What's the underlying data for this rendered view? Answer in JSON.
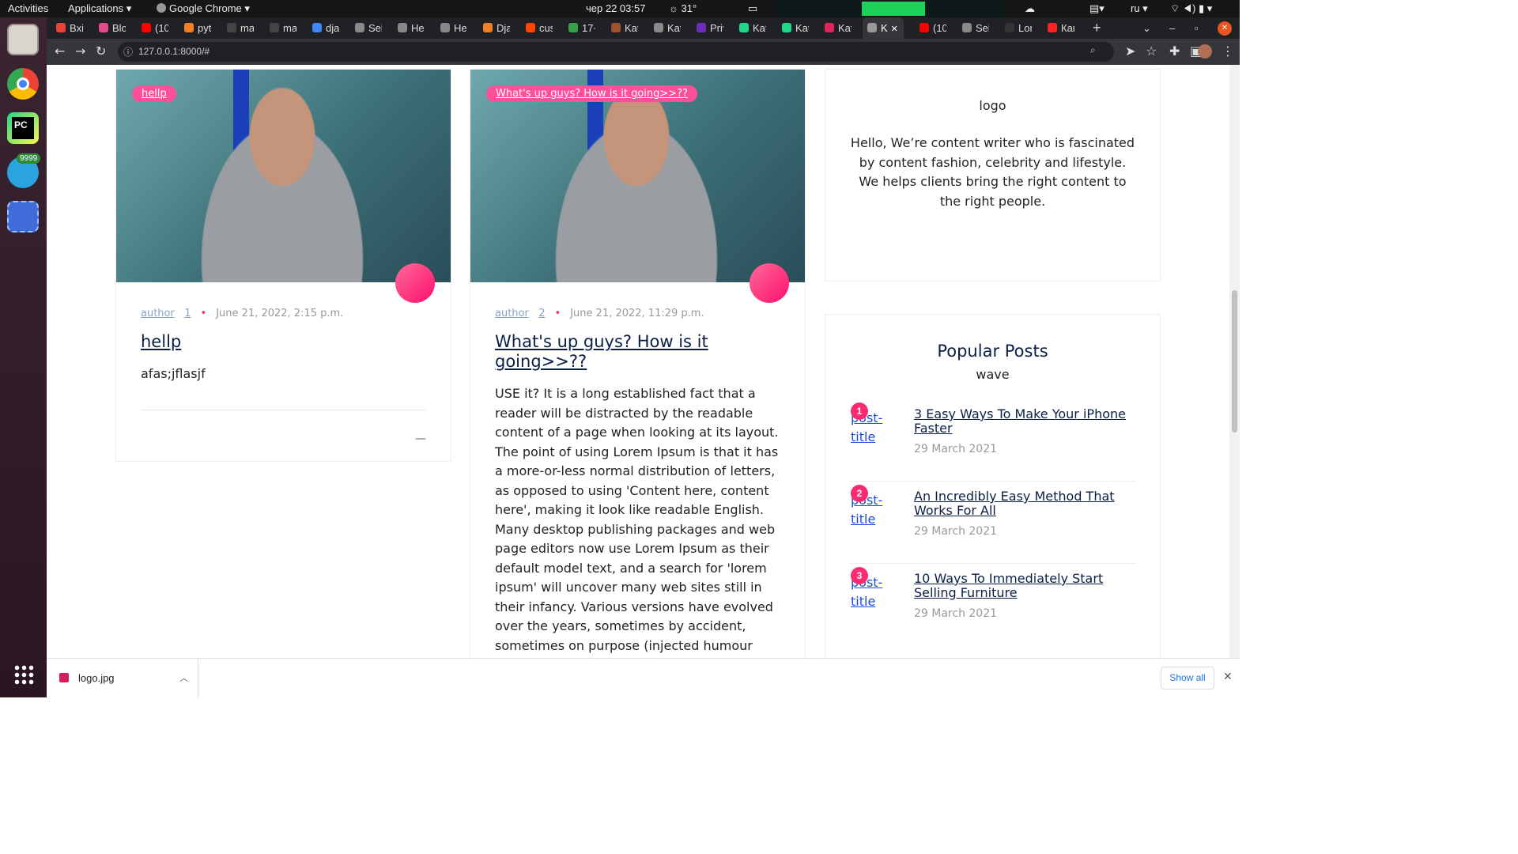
{
  "topbar": {
    "activities": "Activities",
    "applications": "Applications ▾",
    "app_name": "Google Chrome ▾",
    "clock": "чер 22  03:57",
    "temp": "31°",
    "lang": "ru ▾"
  },
  "tabs": [
    {
      "label": "Bxi",
      "color": "#ea4335"
    },
    {
      "label": "Blo",
      "color": "#e64a8a"
    },
    {
      "label": "(10",
      "color": "#ff0000"
    },
    {
      "label": "pyt",
      "color": "#f48024"
    },
    {
      "label": "mar",
      "color": "#444"
    },
    {
      "label": "mar",
      "color": "#444"
    },
    {
      "label": "dja",
      "color": "#4285f4"
    },
    {
      "label": "Sel",
      "color": "#888"
    },
    {
      "label": "Hel",
      "color": "#888"
    },
    {
      "label": "Hel",
      "color": "#888"
    },
    {
      "label": "Dja",
      "color": "#f48024"
    },
    {
      "label": "cus",
      "color": "#ff4500"
    },
    {
      "label": "17+",
      "color": "#37a04a"
    },
    {
      "label": "Kat",
      "color": "#a0522d"
    },
    {
      "label": "Kat",
      "color": "#888"
    },
    {
      "label": "Priv",
      "color": "#6b2fbb"
    },
    {
      "label": "Kat",
      "color": "#21d789"
    },
    {
      "label": "Kat",
      "color": "#21d789"
    },
    {
      "label": "Kat",
      "color": "#e0245e"
    },
    {
      "label": "K",
      "color": "#999",
      "active": true
    },
    {
      "label": "(10",
      "color": "#ff0000"
    },
    {
      "label": "Sel",
      "color": "#888"
    },
    {
      "label": "Lor",
      "color": "#333"
    },
    {
      "label": "Как",
      "color": "#f22"
    }
  ],
  "address": {
    "url": "127.0.0.1:8000/#"
  },
  "dock": {
    "telegram_badge": "9999"
  },
  "posts": [
    {
      "tag": "hellp",
      "author_alt": "author",
      "comments": "1",
      "date": "June 21, 2022, 2:15 p.m.",
      "title": "hellp",
      "excerpt": "afas;jflasjf",
      "dash": "—"
    },
    {
      "tag": "What's up guys? How is it going>>??",
      "author_alt": "author",
      "comments": "2",
      "date": "June 21, 2022, 11:29 p.m.",
      "title": "What's up guys? How is it going>>??",
      "excerpt": "USE it? It is a long established fact that a reader will be distracted by the readable content of a page when looking at its layout. The point of using Lorem Ipsum is that it has a more-or-less normal distribution of letters, as opposed to using 'Content here, content here', making it look like readable English. Many desktop publishing packages and web page editors now use Lorem Ipsum as their default model text, and a search for 'lorem ipsum' will uncover many web sites still in their infancy. Various versions have evolved over the years, sometimes by accident, sometimes on purpose (injected humour and the like)."
    }
  ],
  "about": {
    "logo_alt": "logo",
    "text": "Hello, We’re content writer who is fascinated by content fashion, celebrity and lifestyle. We helps clients bring the right content to the right people."
  },
  "popular": {
    "title": "Popular Posts",
    "wave_alt": "wave",
    "items": [
      {
        "num": "1",
        "thumb_alt": "post-title",
        "title": "3 Easy Ways To Make Your iPhone Faster",
        "date": "29 March 2021"
      },
      {
        "num": "2",
        "thumb_alt": "post-title",
        "title": "An Incredibly Easy Method That Works For All",
        "date": "29 March 2021"
      },
      {
        "num": "3",
        "thumb_alt": "post-title",
        "title": "10 Ways To Immediately Start Selling Furniture",
        "date": "29 March 2021"
      }
    ]
  },
  "download": {
    "file": "logo.jpg",
    "show_all": "Show all"
  }
}
